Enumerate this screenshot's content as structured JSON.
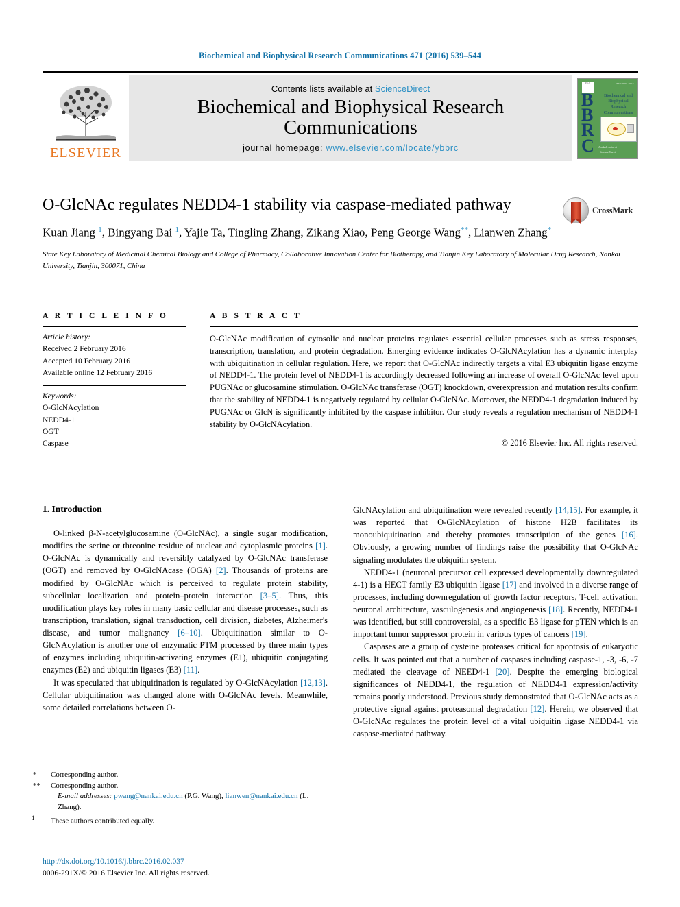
{
  "running_head": "Biochemical and Biophysical Research Communications 471 (2016) 539–544",
  "masthead": {
    "publisher_logo_text": "ELSEVIER",
    "contents_prefix": "Contents lists available at ",
    "contents_link": "ScienceDirect",
    "journal_title": "Biochemical and Biophysical Research Communications",
    "homepage_prefix": "journal homepage: ",
    "homepage_url": "www.elsevier.com/locate/ybbrc",
    "cover": {
      "acronym": "BBRC",
      "title_lines": [
        "Biochemical and",
        "Biophysical",
        "Research",
        "Communications"
      ],
      "corner_note": "ISSN 0006-291X",
      "footer_note": "Available online at",
      "footer_issn": "ScienceDirect"
    }
  },
  "article": {
    "title": "O-GlcNAc regulates NEDD4-1 stability via caspase-mediated pathway",
    "crossmark_label": "CrossMark",
    "authors_html": "Kuan Jiang <sup>1</sup>, Bingyang Bai <sup>1</sup>, Yajie Ta, Tingling Zhang, Zikang Xiao, Peng George Wang<sup class=\"star\">**</sup>, Lianwen Zhang<sup class=\"star\">*</sup>",
    "affiliation": "State Key Laboratory of Medicinal Chemical Biology and College of Pharmacy, Collaborative Innovation Center for Biotherapy, and Tianjin Key Laboratory of Molecular Drug Research, Nankai University, Tianjin, 300071, China"
  },
  "article_info": {
    "heading": "A R T I C L E   I N F O",
    "history_label": "Article history:",
    "history": [
      "Received 2 February 2016",
      "Accepted 10 February 2016",
      "Available online 12 February 2016"
    ],
    "keywords_label": "Keywords:",
    "keywords": [
      "O-GlcNAcylation",
      "NEDD4-1",
      "OGT",
      "Caspase"
    ]
  },
  "abstract": {
    "heading": "A B S T R A C T",
    "text": "O-GlcNAc modification of cytosolic and nuclear proteins regulates essential cellular processes such as stress responses, transcription, translation, and protein degradation. Emerging evidence indicates O-GlcNAcylation has a dynamic interplay with ubiquitination in cellular regulation. Here, we report that O-GlcNAc indirectly targets a vital E3 ubiquitin ligase enzyme of NEDD4-1. The protein level of NEDD4-1 is accordingly decreased following an increase of overall O-GlcNAc level upon PUGNAc or glucosamine stimulation. O-GlcNAc transferase (OGT) knockdown, overexpression and mutation results confirm that the stability of NEDD4-1 is negatively regulated by cellular O-GlcNAc. Moreover, the NEDD4-1 degradation induced by PUGNAc or GlcN is significantly inhibited by the caspase inhibitor. Our study reveals a regulation mechanism of NEDD4-1 stability by O-GlcNAcylation.",
    "copyright": "© 2016 Elsevier Inc. All rights reserved."
  },
  "body": {
    "section_heading": "1. Introduction",
    "left_paragraphs_html": [
      "O-linked β-N-acetylglucosamine (O-GlcNAc), a single sugar modification, modifies the serine or threonine residue of nuclear and cytoplasmic proteins <span class=\"ref\">[1]</span>. O-GlcNAc is dynamically and reversibly catalyzed by O-GlcNAc transferase (OGT) and removed by O-GlcNAcase (OGA) <span class=\"ref\">[2]</span>. Thousands of proteins are modified by O-GlcNAc which is perceived to regulate protein stability, subcellular localization and protein–protein interaction <span class=\"ref\">[3–5]</span>. Thus, this modification plays key roles in many basic cellular and disease processes, such as transcription, translation, signal transduction, cell division, diabetes, Alzheimer's disease, and tumor malignancy <span class=\"ref\">[6–10]</span>. Ubiquitination similar to O-GlcNAcylation is another one of enzymatic PTM processed by three main types of enzymes including ubiquitin-activating enzymes (E1), ubiquitin conjugating enzymes (E2) and ubiquitin ligases (E3) <span class=\"ref\">[11]</span>.",
      "It was speculated that ubiquitination is regulated by O-GlcNAcylation <span class=\"ref\">[12,13]</span>. Cellular ubiquitination was changed alone with O-GlcNAc levels. Meanwhile, some detailed correlations between O-"
    ],
    "right_paragraphs_html": [
      "GlcNAcylation and ubiquitination were revealed recently <span class=\"ref\">[14,15]</span>. For example, it was reported that O-GlcNAcylation of histone H2B facilitates its monoubiquitination and thereby promotes transcription of the genes <span class=\"ref\">[16]</span>. Obviously, a growing number of findings raise the possibility that O-GlcNAc signaling modulates the ubiquitin system.",
      "NEDD4-1 (neuronal precursor cell expressed developmentally downregulated 4-1) is a HECT family E3 ubiquitin ligase <span class=\"ref\">[17]</span> and involved in a diverse range of processes, including downregulation of growth factor receptors, T-cell activation, neuronal architecture, vasculogenesis and angiogenesis <span class=\"ref\">[18]</span>. Recently, NEDD4-1 was identified, but still controversial, as a specific E3 ligase for pTEN which is an important tumor suppressor protein in various types of cancers <span class=\"ref\">[19]</span>.",
      "Caspases are a group of cysteine proteases critical for apoptosis of eukaryotic cells. It was pointed out that a number of caspases including caspase-1, -3, -6, -7 mediated the cleavage of NEED4-1 <span class=\"ref\">[20]</span>. Despite the emerging biological significances of NEDD4-1, the regulation of NEDD4-1 expression/activity remains poorly understood. Previous study demonstrated that O-GlcNAc acts as a protective signal against proteasomal degradation <span class=\"ref\">[12]</span>. Herein, we observed that O-GlcNAc regulates the protein level of a vital ubiquitin ligase NEDD4-1 via caspase-mediated pathway."
    ]
  },
  "footnotes": {
    "corresponding_1": "Corresponding author.",
    "corresponding_2": "Corresponding author.",
    "email_label": "E-mail addresses:",
    "email_1": "pwang@nankai.edu.cn",
    "email_1_name": "(P.G. Wang),",
    "email_2": "lianwen@nankai.edu.cn",
    "email_2_name": "(L. Zhang).",
    "equal_contrib": "These authors contributed equally."
  },
  "publication_footer": {
    "doi": "http://dx.doi.org/10.1016/j.bbrc.2016.02.037",
    "issn_copyright": "0006-291X/© 2016 Elsevier Inc. All rights reserved."
  },
  "colors": {
    "link": "#1272a8",
    "accent_blue": "#2a8fc4",
    "elsevier_orange": "#E87722",
    "cover_green": "#5a9e54"
  }
}
